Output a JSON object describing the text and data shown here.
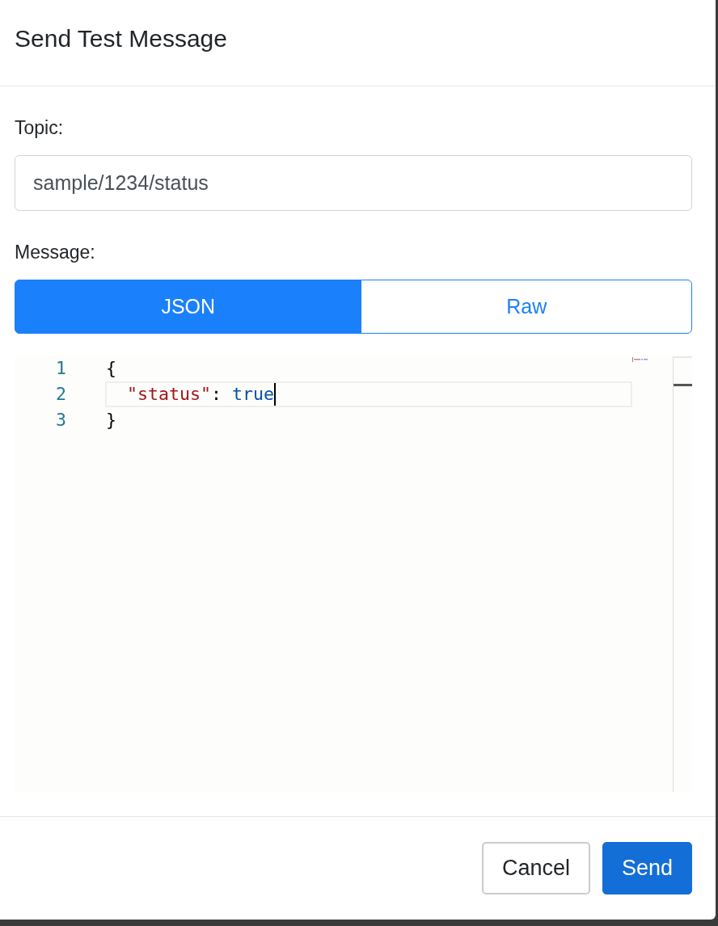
{
  "window": {
    "title": "Send Test Message"
  },
  "form": {
    "topic": {
      "label": "Topic:",
      "value": "sample/1234/status"
    },
    "message": {
      "label": "Message:",
      "tabs": [
        {
          "label": "JSON",
          "selected": true
        },
        {
          "label": "Raw",
          "selected": false
        }
      ],
      "editor": {
        "lines": [
          {
            "number": "1",
            "active": false,
            "tokens": [
              {
                "kind": "punctuation",
                "text": "{"
              }
            ]
          },
          {
            "number": "2",
            "active": true,
            "tokens": [
              {
                "kind": "key",
                "text": "  \"status\""
              },
              {
                "kind": "punctuation",
                "text": ": "
              },
              {
                "kind": "boolean",
                "text": "true"
              }
            ]
          },
          {
            "number": "3",
            "active": false,
            "tokens": [
              {
                "kind": "punctuation",
                "text": "}"
              }
            ]
          }
        ]
      }
    }
  },
  "buttons": [
    {
      "label": "Cancel",
      "kind": "secondary"
    },
    {
      "label": "Send",
      "kind": "primary"
    }
  ]
}
